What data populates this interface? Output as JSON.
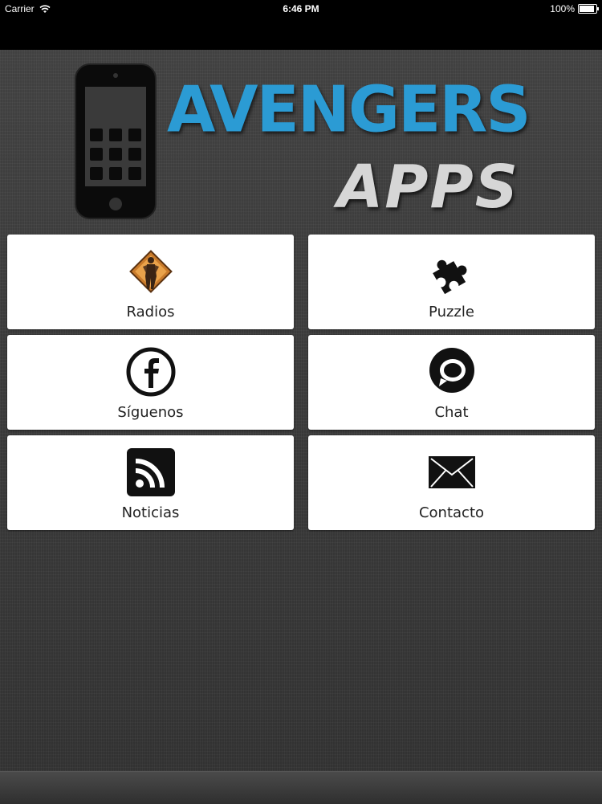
{
  "status_bar": {
    "carrier": "Carrier",
    "time": "6:46 PM",
    "battery": "100%",
    "battery_level": 1.0
  },
  "header": {
    "title": "AVENGERS",
    "subtitle": "APPS"
  },
  "menu": [
    {
      "label": "Radios",
      "icon": "avenger-figure-icon"
    },
    {
      "label": "Puzzle",
      "icon": "puzzle-piece-icon"
    },
    {
      "label": "Síguenos",
      "icon": "facebook-icon"
    },
    {
      "label": "Chat",
      "icon": "chat-bubble-icon"
    },
    {
      "label": "Noticias",
      "icon": "rss-icon"
    },
    {
      "label": "Contacto",
      "icon": "envelope-icon"
    }
  ],
  "colors": {
    "title_blue": "#2b9bd4",
    "subtitle_gray": "#d6d6d6",
    "background": "#3a3a3a"
  }
}
